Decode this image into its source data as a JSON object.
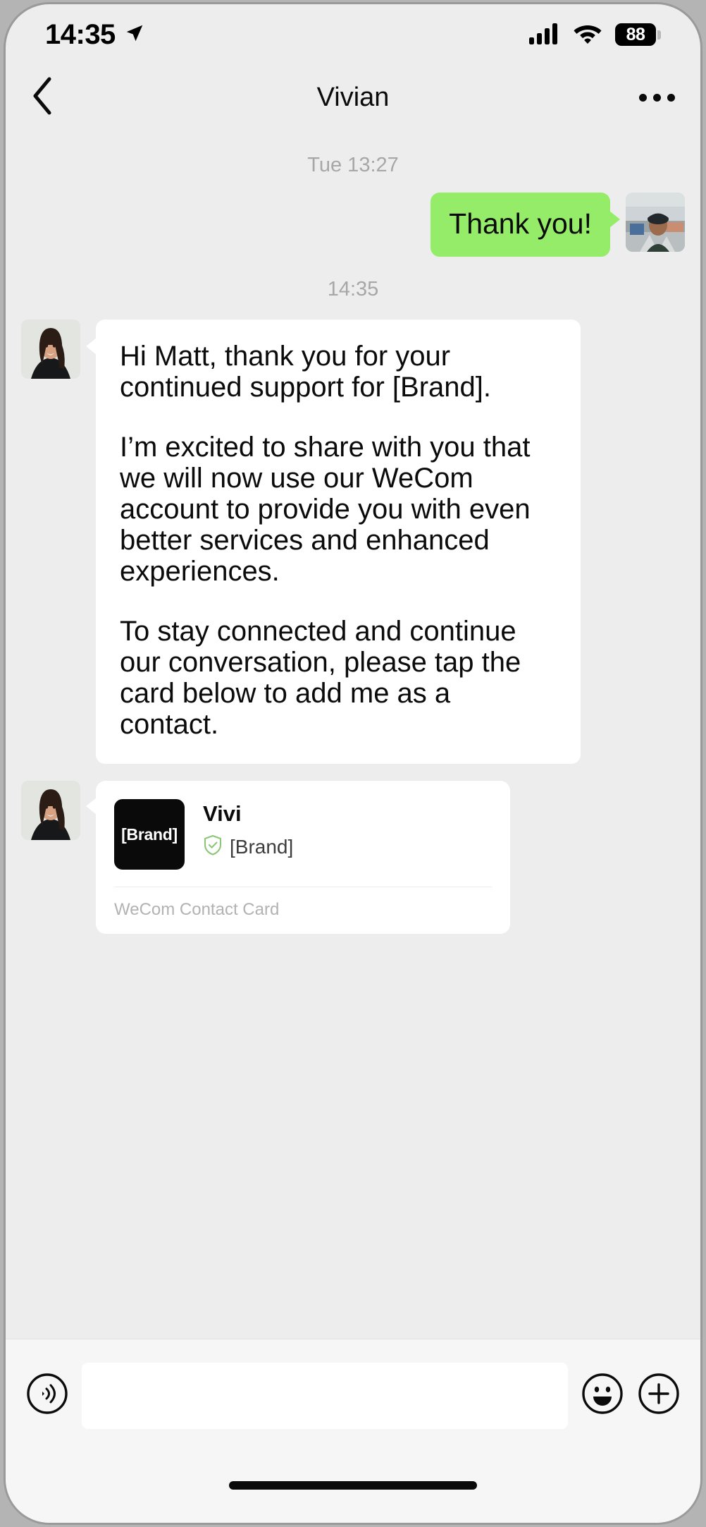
{
  "status_bar": {
    "time": "14:35",
    "battery_percent": "88",
    "location_icon": "location-arrow-icon",
    "signal_icon": "cellular-signal-icon",
    "wifi_icon": "wifi-icon"
  },
  "header": {
    "title": "Vivian",
    "back_icon": "chevron-left-icon",
    "more_icon": "more-horizontal-icon"
  },
  "chat": {
    "divider_1": "Tue 13:27",
    "divider_2": "14:35",
    "outgoing_message": "Thank you!",
    "incoming_message": {
      "paragraph_1": "Hi Matt, thank you for your continued support for [Brand].",
      "paragraph_2": "I’m excited to share with you that we will now use our WeCom account to provide you with even better services and enhanced experiences.",
      "paragraph_3": "To stay connected and continue our conversation, please tap the card below to add me as a contact."
    },
    "contact_card": {
      "logo_text": "[Brand]",
      "name": "Vivi",
      "organization": "[Brand]",
      "verified_icon": "shield-check-icon",
      "footer": "WeCom Contact Card"
    }
  },
  "input_bar": {
    "voice_icon": "voice-message-icon",
    "emoji_icon": "emoji-smiley-icon",
    "plus_icon": "plus-circle-icon",
    "input_value": "",
    "input_placeholder": ""
  },
  "colors": {
    "bubble_green": "#95EC69",
    "bubble_white": "#FFFFFF",
    "chat_background": "#EDEDED",
    "input_background": "#F6F6F6",
    "verified_green": "#8CC677",
    "divider_text": "#A7A7A7"
  }
}
